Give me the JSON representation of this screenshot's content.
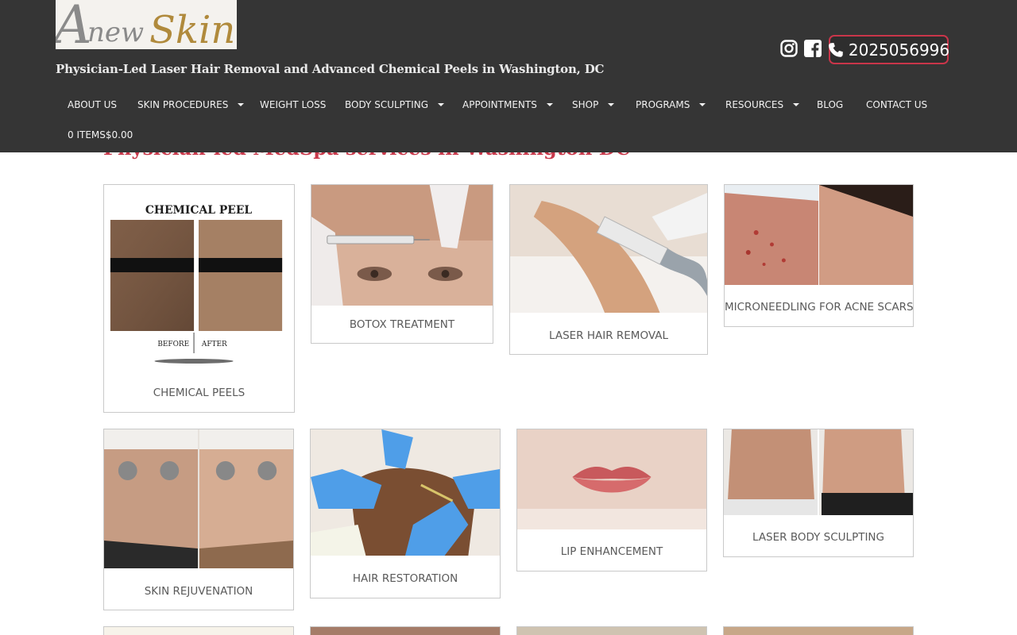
{
  "brand": {
    "logo_text_a": "A",
    "logo_text_new": "new",
    "logo_text_skin": "Skin",
    "tagline": "Physician-Led Laser Hair Removal and Advanced Chemical Peels in Washington, DC"
  },
  "header": {
    "social_icons": [
      "instagram-icon",
      "facebook-icon"
    ],
    "phone_icon": "phone-icon",
    "phone": "2025056996"
  },
  "nav": {
    "items": [
      {
        "label": "ABOUT US",
        "dropdown": false
      },
      {
        "label": "SKIN PROCEDURES",
        "dropdown": true
      },
      {
        "label": "WEIGHT LOSS",
        "dropdown": false
      },
      {
        "label": "BODY SCULPTING",
        "dropdown": true
      },
      {
        "label": "APPOINTMENTS",
        "dropdown": true
      },
      {
        "label": "SHOP",
        "dropdown": true
      },
      {
        "label": "PROGRAMS",
        "dropdown": true
      },
      {
        "label": "RESOURCES",
        "dropdown": true
      },
      {
        "label": "BLOG",
        "dropdown": false
      },
      {
        "label": "CONTACT US",
        "dropdown": false
      }
    ],
    "cart": "0 ITEMS$0.00"
  },
  "main": {
    "heading": "Physician-led MedSpa services in Washington DC",
    "services": [
      {
        "label": "CHEMICAL PEELS",
        "image_title": "CHEMICAL PEEL",
        "before": "BEFORE",
        "after": "AFTER"
      },
      {
        "label": "BOTOX TREATMENT"
      },
      {
        "label": "LASER HAIR REMOVAL"
      },
      {
        "label": "MICRONEEDLING FOR ACNE SCARS"
      },
      {
        "label": "SKIN REJUVENATION"
      },
      {
        "label": "HAIR RESTORATION"
      },
      {
        "label": "LIP ENHANCEMENT"
      },
      {
        "label": "LASER BODY SCULPTING"
      }
    ]
  },
  "colors": {
    "header_bg": "#353535",
    "accent_red": "#c8394b",
    "logo_gold": "#b08a3c",
    "card_border": "#c9c9c9"
  }
}
